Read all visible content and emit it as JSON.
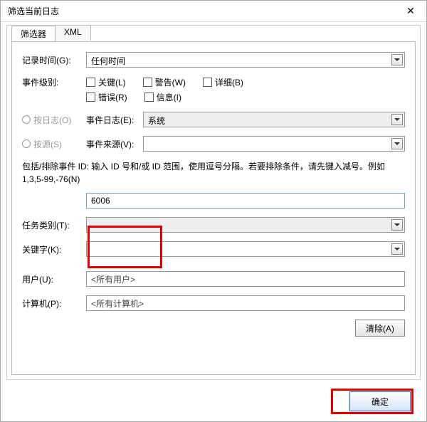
{
  "window": {
    "title": "筛选当前日志"
  },
  "tabs": {
    "filter": "筛选器",
    "xml": "XML"
  },
  "labels": {
    "logged": "记录时间(G):",
    "level": "事件级别:",
    "byLog": "按日志(O)",
    "bySource": "按源(S)",
    "eventLogs": "事件日志(E):",
    "eventSources": "事件来源(V):",
    "idsHelp": "包括/排除事件 ID: 输入 ID 号和/或 ID 范围，使用逗号分隔。若要排除条件，请先键入减号。例如 1,3,5-99,-76(N)",
    "taskCat": "任务类别(T):",
    "keywords": "关键字(K):",
    "user": "用户(U):",
    "computer": "计算机(P):"
  },
  "levels": {
    "critical": "关键(L)",
    "warning": "警告(W)",
    "verbose": "详细(B)",
    "error": "错误(R)",
    "info": "信息(I)"
  },
  "values": {
    "logged": "任何时间",
    "eventLogs": "系统",
    "eventSources": "",
    "eventId": "6006",
    "taskCat": "",
    "keywords": "",
    "user": "<所有用户>",
    "computer": "<所有计算机>"
  },
  "buttons": {
    "clear": "清除(A)",
    "ok": "确定"
  }
}
